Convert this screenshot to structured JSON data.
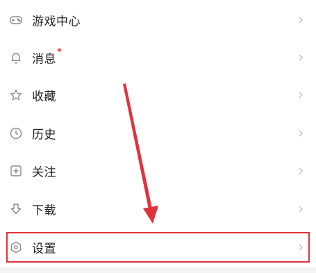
{
  "menu": {
    "items": [
      {
        "label": "游戏中心",
        "icon": "gamepad-icon",
        "has_dot": false
      },
      {
        "label": "消息",
        "icon": "bell-icon",
        "has_dot": true
      },
      {
        "label": "收藏",
        "icon": "star-icon",
        "has_dot": false
      },
      {
        "label": "历史",
        "icon": "clock-icon",
        "has_dot": false
      },
      {
        "label": "关注",
        "icon": "follow-plus-icon",
        "has_dot": false
      },
      {
        "label": "下载",
        "icon": "download-icon",
        "has_dot": false
      },
      {
        "label": "设置",
        "icon": "settings-hexagon-icon",
        "has_dot": false
      }
    ]
  },
  "annotation": {
    "highlighted_item": "设置",
    "highlight_color": "#e0323d",
    "arrow_color": "#e0323d"
  },
  "colors": {
    "icon": "#8a8a8a",
    "chevron": "#c4c4c4",
    "badge": "#ff4d4f",
    "text": "#222222"
  }
}
